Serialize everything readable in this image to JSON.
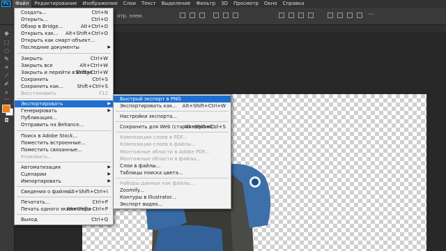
{
  "app": {
    "logo": "Ps"
  },
  "menubar": {
    "items": [
      "Файл",
      "Редактирование",
      "Изображение",
      "Слои",
      "Текст",
      "Выделение",
      "Фильтр",
      "3D",
      "Просмотр",
      "Окно",
      "Справка"
    ],
    "active_index": 0
  },
  "options_bar": {
    "text": "отр. элем."
  },
  "file_menu": {
    "items": [
      {
        "label": "Создать...",
        "shortcut": "Ctrl+N"
      },
      {
        "label": "Открыть...",
        "shortcut": "Ctrl+O"
      },
      {
        "label": "Обзор в Bridge...",
        "shortcut": "Alt+Ctrl+O"
      },
      {
        "label": "Открыть как...",
        "shortcut": "Alt+Shift+Ctrl+O"
      },
      {
        "label": "Открыть как смарт-объект...",
        "shortcut": ""
      },
      {
        "label": "Последние документы",
        "shortcut": "",
        "submenu": true
      },
      {
        "label": "Закрыть",
        "shortcut": "Ctrl+W"
      },
      {
        "label": "Закрыть все",
        "shortcut": "Alt+Ctrl+W"
      },
      {
        "label": "Закрыть и перейти в Bridge...",
        "shortcut": "Shift+Ctrl+W"
      },
      {
        "label": "Сохранить",
        "shortcut": "Ctrl+S"
      },
      {
        "label": "Сохранить как...",
        "shortcut": "Shift+Ctrl+S"
      },
      {
        "label": "Восстановить",
        "shortcut": "F12",
        "disabled": true
      },
      {
        "label": "Экспортировать",
        "shortcut": "",
        "submenu": true,
        "highlighted": true
      },
      {
        "label": "Генерировать",
        "shortcut": "",
        "submenu": true
      },
      {
        "label": "Публикация...",
        "shortcut": ""
      },
      {
        "label": "Отправить на Behance...",
        "shortcut": ""
      },
      {
        "label": "Поиск в Adobe Stock...",
        "shortcut": ""
      },
      {
        "label": "Поместить встроенные...",
        "shortcut": ""
      },
      {
        "label": "Поместить связанные...",
        "shortcut": ""
      },
      {
        "label": "Упаковать...",
        "shortcut": "",
        "disabled": true
      },
      {
        "label": "Автоматизация",
        "shortcut": "",
        "submenu": true
      },
      {
        "label": "Сценарии",
        "shortcut": "",
        "submenu": true
      },
      {
        "label": "Импортировать",
        "shortcut": "",
        "submenu": true
      },
      {
        "label": "Сведения о файле...",
        "shortcut": "Alt+Shift+Ctrl+I"
      },
      {
        "label": "Печатать...",
        "shortcut": "Ctrl+P"
      },
      {
        "label": "Печать одного экземпляра",
        "shortcut": "Alt+Shift+Ctrl+P"
      },
      {
        "label": "Выход",
        "shortcut": "Ctrl+Q"
      }
    ]
  },
  "export_menu": {
    "items": [
      {
        "label": "Быстрый экспорт в PNG",
        "shortcut": "",
        "highlighted": true
      },
      {
        "label": "Экспортировать как...",
        "shortcut": "Alt+Shift+Ctrl+W"
      },
      {
        "label": "Настройки экспорта...",
        "shortcut": ""
      },
      {
        "label": "Сохранить для Web (старая версия)...",
        "shortcut": "Alt+Shift+Ctrl+S"
      },
      {
        "label": "Композиции слоев в PDF...",
        "shortcut": "",
        "disabled": true
      },
      {
        "label": "Композиции слоев в файлы...",
        "shortcut": "",
        "disabled": true
      },
      {
        "label": "Монтажные области в Adobe PDF...",
        "shortcut": "",
        "disabled": true
      },
      {
        "label": "Монтажные области в файлы...",
        "shortcut": "",
        "disabled": true
      },
      {
        "label": "Слои в файлы...",
        "shortcut": ""
      },
      {
        "label": "Таблицы поиска цвета...",
        "shortcut": ""
      },
      {
        "label": "Наборы данных как файлы...",
        "shortcut": "",
        "disabled": true
      },
      {
        "label": "Zoomify...",
        "shortcut": ""
      },
      {
        "label": "Контуры в Illustrator...",
        "shortcut": ""
      },
      {
        "label": "Экспорт видео...",
        "shortcut": ""
      }
    ]
  },
  "colors": {
    "accent": "#1f6fd0",
    "foreground_swatch": "#f0821e",
    "background_swatch": "#ffffff"
  }
}
